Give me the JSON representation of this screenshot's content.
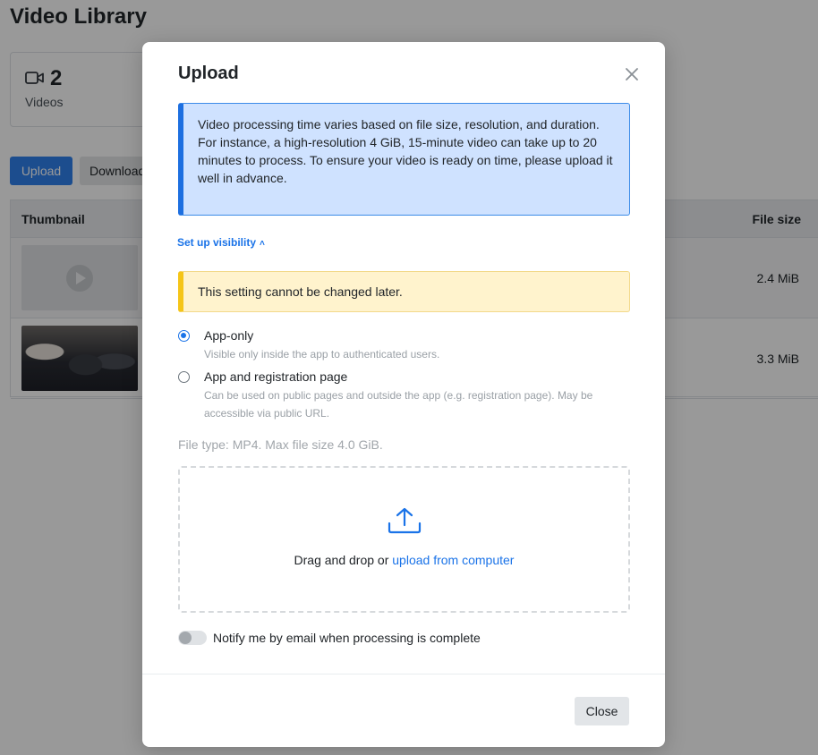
{
  "page": {
    "title": "Video Library",
    "stat": {
      "count": "2",
      "label": "Videos",
      "icon": "video-camera-icon"
    },
    "buttons": {
      "upload": "Upload",
      "download": "Download"
    },
    "table": {
      "columns": {
        "thumbnail": "Thumbnail",
        "file_size": "File size"
      },
      "rows": [
        {
          "thumbnail": "placeholder-play",
          "file_size": "2.4 MiB"
        },
        {
          "thumbnail": "conference-photo",
          "file_size": "3.3 MiB"
        }
      ]
    }
  },
  "modal": {
    "title": "Upload",
    "info": {
      "line1": "Video processing time varies based on file size, resolution, and duration.",
      "line2": "For instance, a high-resolution 4 GiB, 15-minute video can take up to 20 minutes to process. To ensure your video is ready on time, please upload it well in advance."
    },
    "visibility_toggle": "Set up visibility",
    "warning": "This setting cannot be changed later.",
    "visibility_options": [
      {
        "label": "App-only",
        "description": "Visible only inside the app to authenticated users.",
        "selected": true
      },
      {
        "label": "App and registration page",
        "description": "Can be used on public pages and outside the app (e.g. registration page). May be accessible via public URL.",
        "selected": false
      }
    ],
    "file_hint": "File type: MP4. Max file size 4.0 GiB.",
    "dropzone": {
      "text": "Drag and drop or",
      "link": "upload from computer"
    },
    "notify": {
      "label": "Notify me by email when processing is complete",
      "enabled": false
    },
    "close_button": "Close"
  },
  "colors": {
    "primary": "#1a73e8",
    "info_bg": "#cfe2ff",
    "warning_bg": "#fff3cd",
    "warning_accent": "#f5c518"
  }
}
